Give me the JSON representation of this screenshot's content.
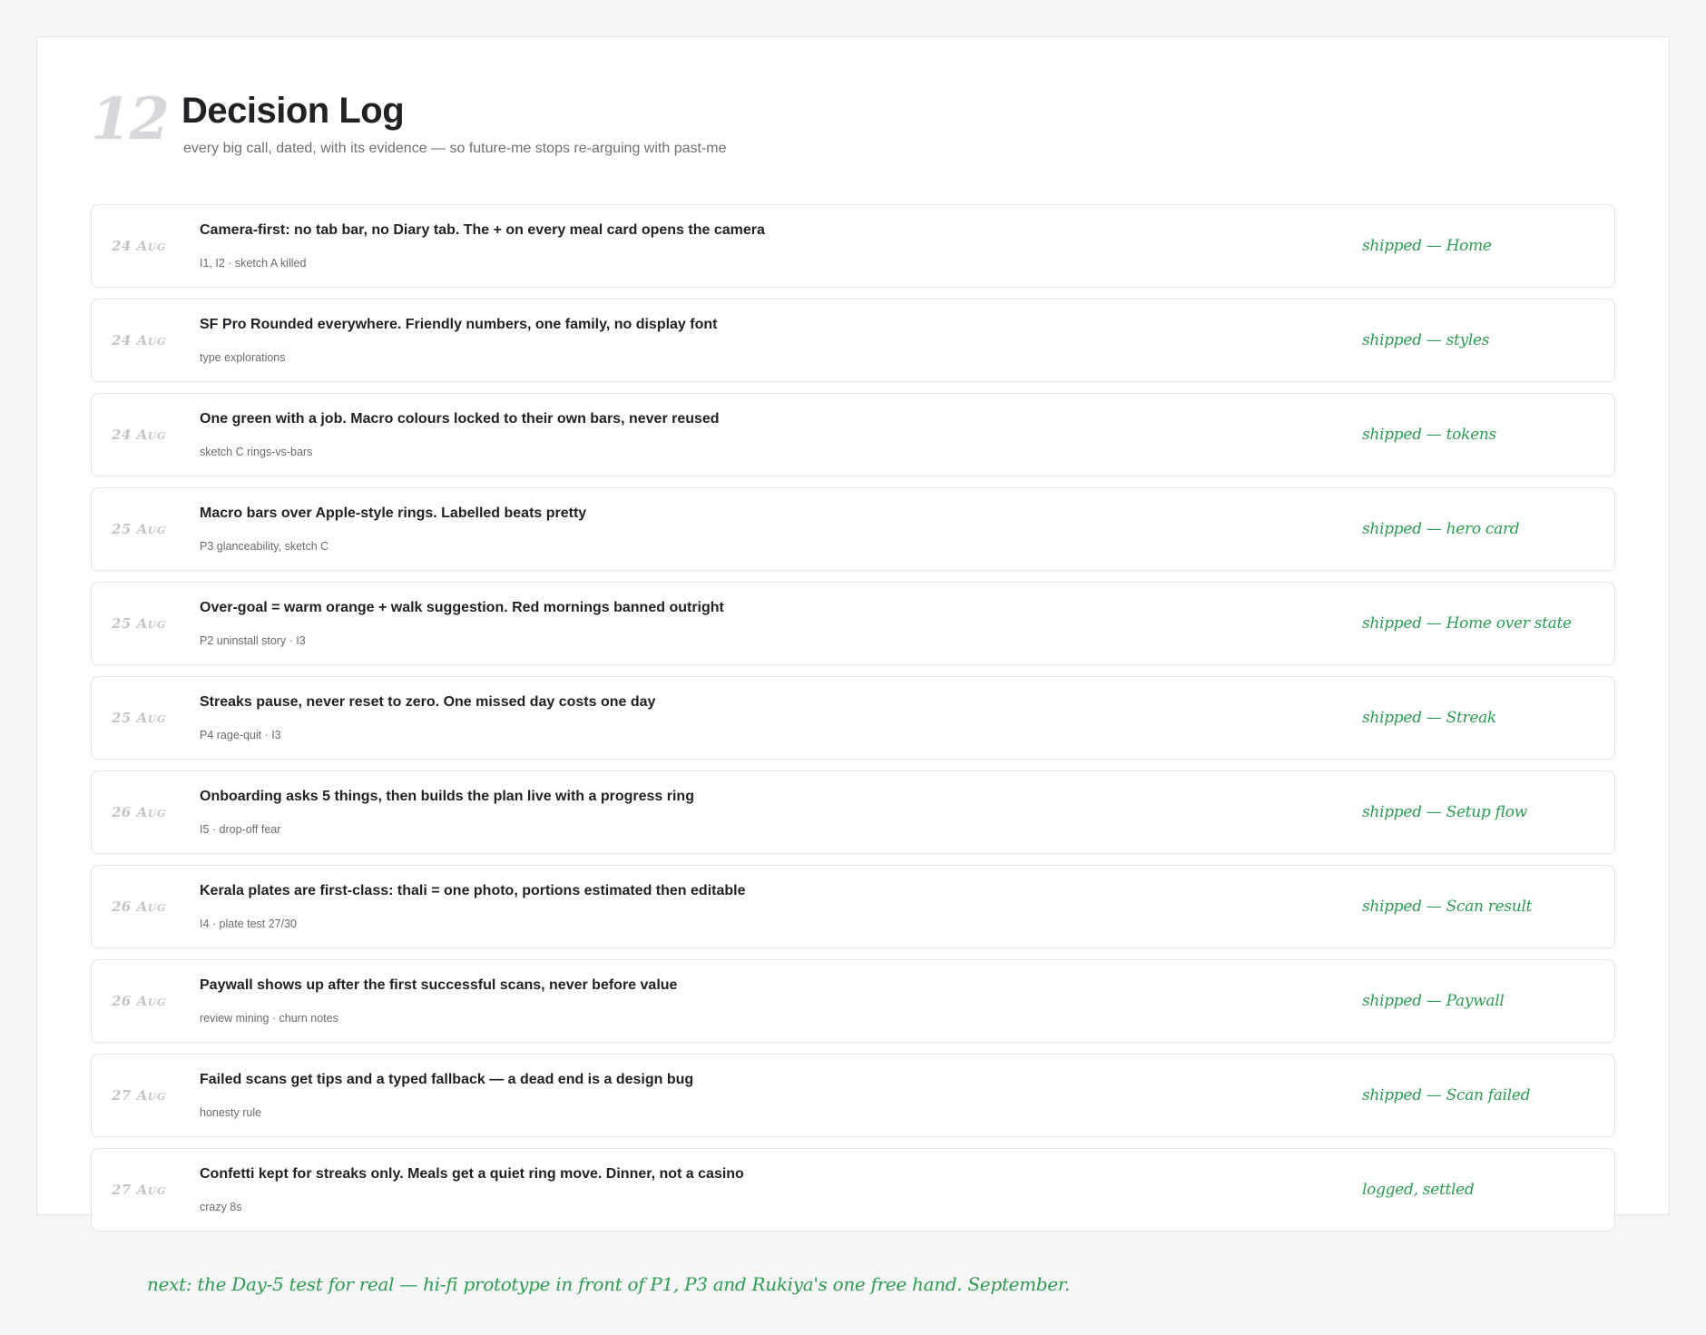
{
  "header": {
    "section_number": "12",
    "title": "Decision Log",
    "subtitle": "every big call, dated, with its evidence — so future-me stops re-arguing with past-me"
  },
  "decisions": [
    {
      "date": "24 Aug",
      "title": "Camera-first: no tab bar, no Diary tab. The + on every meal card opens the camera",
      "evidence": "I1, I2 · sketch A killed",
      "status": "shipped — Home"
    },
    {
      "date": "24 Aug",
      "title": "SF Pro Rounded everywhere. Friendly numbers, one family, no display font",
      "evidence": "type explorations",
      "status": "shipped — styles"
    },
    {
      "date": "24 Aug",
      "title": "One green with a job. Macro colours locked to their own bars, never reused",
      "evidence": "sketch C rings-vs-bars",
      "status": "shipped — tokens"
    },
    {
      "date": "25 Aug",
      "title": "Macro bars over Apple-style rings. Labelled beats pretty",
      "evidence": "P3 glanceability, sketch C",
      "status": "shipped — hero card"
    },
    {
      "date": "25 Aug",
      "title": "Over-goal = warm orange + walk suggestion. Red mornings banned outright",
      "evidence": "P2 uninstall story · I3",
      "status": "shipped — Home over state"
    },
    {
      "date": "25 Aug",
      "title": "Streaks pause, never reset to zero. One missed day costs one day",
      "evidence": "P4 rage-quit · I3",
      "status": "shipped — Streak"
    },
    {
      "date": "26 Aug",
      "title": "Onboarding asks 5 things, then builds the plan live with a progress ring",
      "evidence": "I5 · drop-off fear",
      "status": "shipped — Setup flow"
    },
    {
      "date": "26 Aug",
      "title": "Kerala plates are first-class: thali = one photo, portions estimated then editable",
      "evidence": "I4 · plate test 27/30",
      "status": "shipped — Scan result"
    },
    {
      "date": "26 Aug",
      "title": "Paywall shows up after the first successful scans, never before value",
      "evidence": "review mining · churn notes",
      "status": "shipped — Paywall"
    },
    {
      "date": "27 Aug",
      "title": "Failed scans get tips and a typed fallback — a dead end is a design bug",
      "evidence": "honesty rule",
      "status": "shipped — Scan failed"
    },
    {
      "date": "27 Aug",
      "title": "Confetti kept for streaks only. Meals get a quiet ring move. Dinner, not a casino",
      "evidence": "crazy 8s",
      "status": "logged, settled"
    }
  ],
  "footer": {
    "next_note": "next: the Day-5 test for real — hi-fi prototype in front of P1, P3 and Rukiya's one free hand. September."
  },
  "colors": {
    "accent_green": "#2e9a52",
    "title_text": "#222226",
    "muted_text": "#6a6a70",
    "date_text": "#c4c4c8",
    "card_border": "#e4e4e8"
  }
}
